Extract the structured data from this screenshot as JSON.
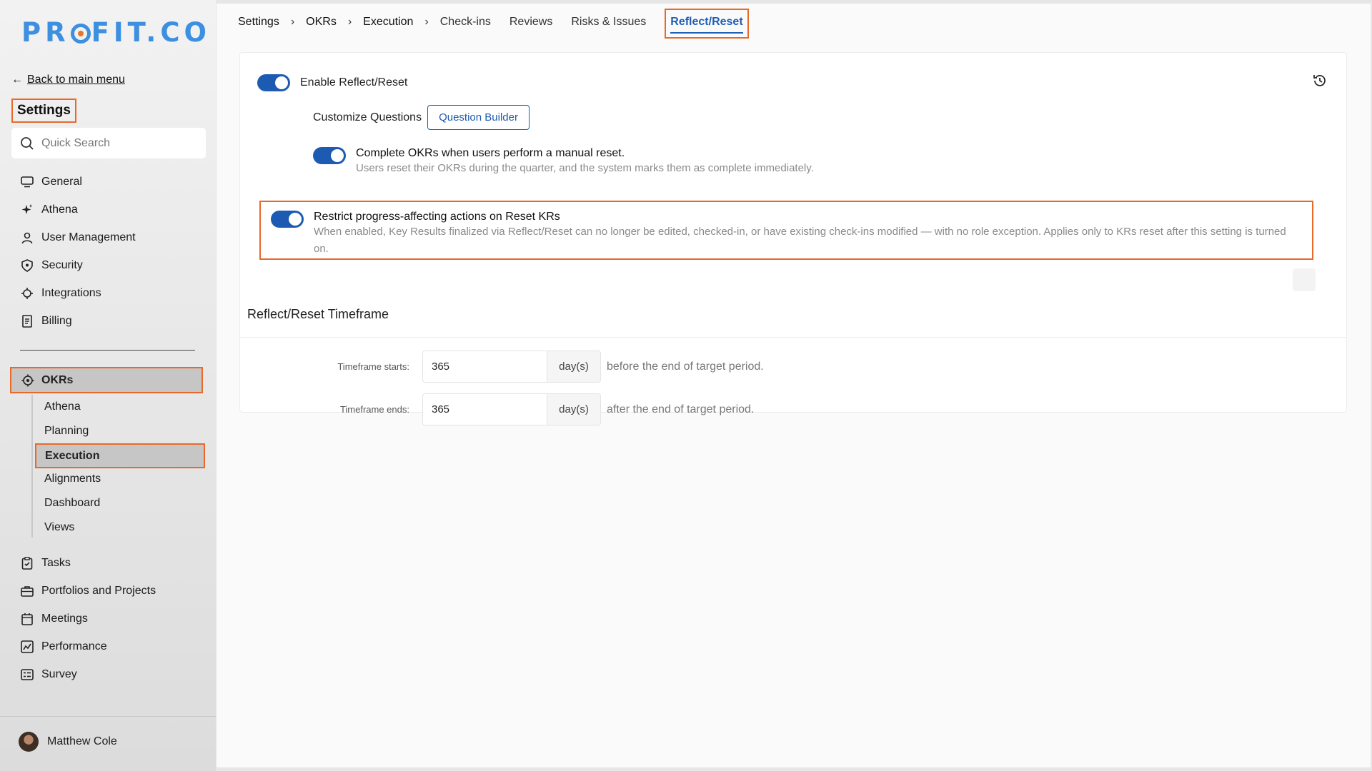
{
  "brand": {
    "logo_text_a": "PR",
    "logo_text_b": "FIT.CO"
  },
  "sidebar": {
    "back_label": "Back to main menu",
    "title": "Settings",
    "search_placeholder": "Quick Search",
    "top_items": [
      {
        "label": "General",
        "icon": "monitor-icon"
      },
      {
        "label": "Athena",
        "icon": "sparkle-icon"
      },
      {
        "label": "User Management",
        "icon": "user-icon"
      },
      {
        "label": "Security",
        "icon": "shield-icon"
      },
      {
        "label": "Integrations",
        "icon": "puzzle-icon"
      },
      {
        "label": "Billing",
        "icon": "receipt-icon"
      }
    ],
    "okrs_label": "OKRs",
    "okr_sub": [
      "Athena",
      "Planning",
      "Execution",
      "Alignments",
      "Dashboard",
      "Views"
    ],
    "active_sub": "Execution",
    "bottom_items": [
      {
        "label": "Tasks",
        "icon": "clipboard-icon"
      },
      {
        "label": "Portfolios and Projects",
        "icon": "briefcase-icon"
      },
      {
        "label": "Meetings",
        "icon": "calendar-icon"
      },
      {
        "label": "Performance",
        "icon": "chart-icon"
      },
      {
        "label": "Survey",
        "icon": "survey-icon"
      }
    ],
    "user_name": "Matthew Cole"
  },
  "tabs": {
    "crumbs": [
      "Settings",
      "OKRs",
      "Execution"
    ],
    "items": [
      "Check-ins",
      "Reviews",
      "Risks & Issues"
    ],
    "active": "Reflect/Reset"
  },
  "content": {
    "enable_label": "Enable Reflect/Reset",
    "customize_label": "Customize Questions",
    "question_builder": "Question Builder",
    "complete_title": "Complete OKRs when users perform a manual reset.",
    "complete_desc": "Users reset their OKRs during the quarter, and the system marks them as complete immediately.",
    "restrict_title": "Restrict progress-affecting actions on Reset KRs",
    "restrict_desc": "When enabled, Key Results finalized via Reflect/Reset can no longer be edited, checked-in, or have existing check-ins modified — with no role exception. Applies only to KRs reset after this setting is turned on.",
    "timeframe_title": "Reflect/Reset Timeframe",
    "starts_label": "Timeframe starts:",
    "starts_value": "365",
    "starts_after": "before the end of target period.",
    "ends_label": "Timeframe ends:",
    "ends_value": "365",
    "ends_after": "after the end of target period.",
    "unit": "day(s)"
  },
  "colors": {
    "accent": "#1d5bb3",
    "highlight": "#e8692a",
    "logo": "#3d8fe0"
  }
}
